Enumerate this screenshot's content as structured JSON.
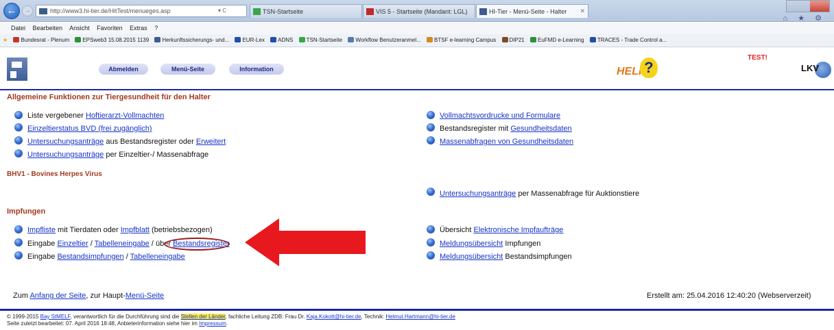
{
  "browser": {
    "address": "http://www3.hi-tier.de/HitTest/menueges.asp",
    "addr_controls": "▾ C",
    "tabs": [
      {
        "label": "TSN-Startseite"
      },
      {
        "label": "VIS 5 - Startseite (Mandant: LGL)"
      },
      {
        "label": "HI-Tier - Menü-Seite - Halter"
      }
    ],
    "right_icons": "⌂ ★ ⚙",
    "menu": [
      "Datei",
      "Bearbeiten",
      "Ansicht",
      "Favoriten",
      "Extras",
      "?"
    ],
    "favorites": [
      "Bundesrat - Plenum",
      "EPSweb3 15.08.2015 1139",
      "Herkunftssicherungs- und...",
      "EUR-Lex",
      "ADNS",
      "TSN-Startseite",
      "Workflow Benutzeranmel...",
      "BTSF e-learning Campus",
      "DIP21",
      "EuFMD e-Learning",
      "TRACES - Trade Control a..."
    ]
  },
  "header": {
    "nav": [
      "Abmelden",
      "Menü-Seite",
      "Information"
    ],
    "help": {
      "text": "HELP",
      "mark": "?"
    },
    "test_label": "TEST!",
    "lkv_text": "LKV"
  },
  "sections": {
    "allgemein_title": "Allgemeine Funktionen zur Tiergesundheit für den Halter",
    "bhv1_title": "BHV1 - Bovines Herpes Virus",
    "impfungen_title": "Impfungen"
  },
  "left": {
    "l1_pre": "Liste vergebener ",
    "l1_link": "Hoftierarzt-Vollmachten",
    "l2_link": "Einzeltierstatus BVD (frei zugänglich)",
    "l3_link1": "Untersuchungsanträge",
    "l3_mid": " aus Bestandsregister oder ",
    "l3_link2": "Erweitert",
    "l4_link": "Untersuchungsanträge",
    "l4_post": " per Einzeltier-/ Massenabfrage",
    "i1_link1": "Impfliste",
    "i1_mid": " mit Tierdaten oder ",
    "i1_link2": "Impfblatt",
    "i1_post": " (betriebsbezogen)",
    "i2_pre": "Eingabe ",
    "i2_link1": "Einzeltier",
    "i2_sep": " / ",
    "i2_link2": "Tabelleneingabe",
    "i2_mid": " / über ",
    "i2_link3": "Bestandsregister",
    "i3_pre": "Eingabe ",
    "i3_link1": "Bestandsimpfungen",
    "i3_sep": " / ",
    "i3_link2": "Tabelleneingabe"
  },
  "right": {
    "r1_link": "Vollmachtsvordrucke und Formulare",
    "r2_pre": "Bestandsregister mit ",
    "r2_link": "Gesundheitsdaten",
    "r3_link": "Massenabfragen von Gesundheitsdaten",
    "b1_link": "Untersuchungsanträge",
    "b1_post": " per Massenabfrage für Auktionstiere",
    "ri1_pre": "Übersicht ",
    "ri1_link": "Elektronische Impfaufträge",
    "ri2_link": "Meldungsübersicht",
    "ri2_post": " Impfungen",
    "ri3_link": "Meldungsübersicht",
    "ri3_post": " Bestandsimpfungen"
  },
  "footer": {
    "zum": "Zum ",
    "anfang_link": "Anfang der Seite",
    "zur": ",   zur Haupt-",
    "menu_link": "Menü-Seite",
    "created": "Erstellt am: 25.04.2016 12:40:20 (Webserverzeit)"
  },
  "copyright": {
    "c_pre": "© 1999-2015 ",
    "c_link1": "Bay StMELF",
    "c_mid1": ", verantwortlich für die Durchführung sind die ",
    "c_link2": "Stellen der Länder",
    "c_mid2": ", fachliche Leitung ZDB: Frau Dr. ",
    "c_link3": "Kaja.Kokott@hi-tier.de",
    "c_mid3": ", Technik: ",
    "c_link4": "Helmut.Hartmann@hi-tier.de",
    "line2_pre": "Seite zuletzt bearbeitet: 07. April 2016 18:48, Anbieterinformation siehe hier im ",
    "line2_link": "Impressum",
    "line2_post": "."
  },
  "colors": {
    "section": "#a3381d",
    "link": "#1533c8",
    "rule": "#1b2aa8",
    "arrow": "#e8191e",
    "test": "#e02222"
  }
}
